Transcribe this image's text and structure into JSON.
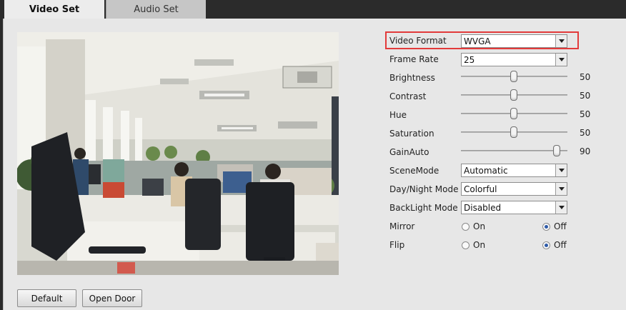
{
  "tabs": [
    {
      "label": "Video Set",
      "active": true
    },
    {
      "label": "Audio Set",
      "active": false
    }
  ],
  "video_format": {
    "label": "Video Format",
    "value": "WVGA"
  },
  "frame_rate": {
    "label": "Frame Rate",
    "value": "25"
  },
  "sliders": [
    {
      "label": "Brightness",
      "value": "50",
      "level": 0.5
    },
    {
      "label": "Contrast",
      "value": "50",
      "level": 0.5
    },
    {
      "label": "Hue",
      "value": "50",
      "level": 0.5
    },
    {
      "label": "Saturation",
      "value": "50",
      "level": 0.5
    },
    {
      "label": "GainAuto",
      "value": "90",
      "level": 0.9
    }
  ],
  "scene_mode": {
    "label": "SceneMode",
    "value": "Automatic"
  },
  "day_night_mode": {
    "label": "Day/Night Mode",
    "value": "Colorful"
  },
  "backlight_mode": {
    "label": "BackLight Mode",
    "value": "Disabled"
  },
  "mirror": {
    "label": "Mirror",
    "on_label": "On",
    "off_label": "Off",
    "selected": "Off"
  },
  "flip": {
    "label": "Flip",
    "on_label": "On",
    "off_label": "Off",
    "selected": "Off"
  },
  "buttons": {
    "default_label": "Default",
    "open_door_label": "Open Door"
  },
  "colors": {
    "highlight_border": "#e23a3a",
    "radio_selected": "#2d5aa8"
  }
}
